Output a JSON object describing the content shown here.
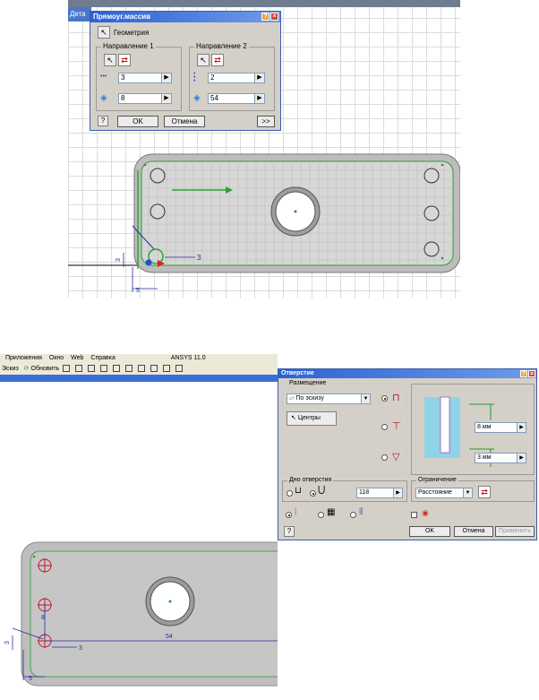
{
  "top": {
    "left_tab": "Дета",
    "dialog": {
      "title": "Прямоуг.массив",
      "geometry_label": "Геометрия",
      "dir1": {
        "label": "Направление 1",
        "count": "3",
        "distance": "8"
      },
      "dir2": {
        "label": "Направление 2",
        "count": "2",
        "distance": "54"
      },
      "ok": "OK",
      "cancel": "Отмена",
      "more": ">>"
    },
    "sketch": {
      "dim_vertical": "3",
      "dim_horizontal": "3",
      "dim_offset": "5"
    }
  },
  "bottom": {
    "menu": [
      "Приложения",
      "Окно",
      "Web",
      "Справка",
      "ANSYS 11.0"
    ],
    "toolbar": {
      "sketch": "Эскиз",
      "update": "Обновить"
    },
    "dialog": {
      "title": "Отверстие",
      "placement_label": "Размещение",
      "placement_value": "По эскизу",
      "centers": "Центры",
      "depth_top": "8 мм",
      "depth_bottom": "3 мм",
      "bottom_label": "Дно отверстия",
      "angle": "118",
      "limit_label": "Ограничение",
      "limit_value": "Расстояние",
      "ok": "OK",
      "cancel": "Отмена",
      "apply": "Применить"
    },
    "sketch": {
      "dim_54": "54",
      "dim_3": "3",
      "dim_5": "5",
      "dim_side": "3",
      "dim_8": "8"
    }
  },
  "colors": {
    "title_blue": "#2b62d6",
    "dialog_gray": "#d4d0c8",
    "plate": "#b8b8b8",
    "hole_red": "#c0192c",
    "dim_blue": "#1f2f9c",
    "sketch_green": "#2a9a2a"
  }
}
